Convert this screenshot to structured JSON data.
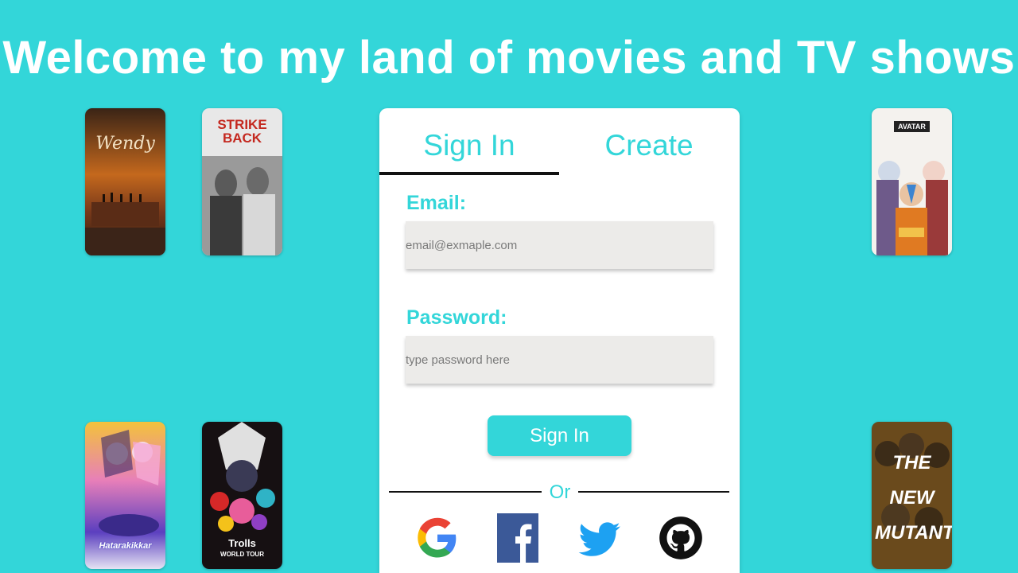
{
  "header": {
    "title": "Welcome to my land of movies and TV shows"
  },
  "posters": [
    {
      "title": "Wendy"
    },
    {
      "title": "STRIKE BACK"
    },
    {
      "title": "AVATAR"
    },
    {
      "title": "Hatarakikkar"
    },
    {
      "title": "Trolls",
      "subtitle": "WORLD TOUR"
    },
    {
      "title": "THE NEW MUTANTS"
    }
  ],
  "auth": {
    "tabs": {
      "signin_label": "Sign In",
      "create_label": "Create"
    },
    "email_label": "Email:",
    "email_placeholder": "email@exmaple.com",
    "password_label": "Password:",
    "password_placeholder": "type password here",
    "submit_label": "Sign In",
    "or_text": "Or"
  },
  "social": [
    "google-icon",
    "facebook-icon",
    "twitter-icon",
    "github-icon"
  ],
  "colors": {
    "background": "#33d6d9",
    "accent": "#33d6d9",
    "card": "#ffffff",
    "input": "#ecebe9"
  }
}
